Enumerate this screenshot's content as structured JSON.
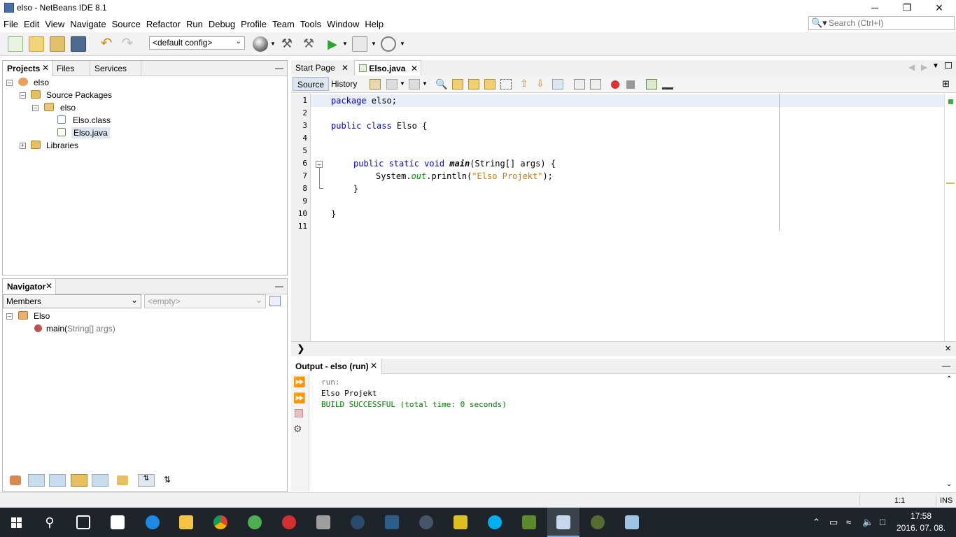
{
  "window": {
    "title": "elso - NetBeans IDE 8.1",
    "minimize": "─",
    "maximize": "❐",
    "close": "✕"
  },
  "menu": [
    "File",
    "Edit",
    "View",
    "Navigate",
    "Source",
    "Refactor",
    "Run",
    "Debug",
    "Profile",
    "Team",
    "Tools",
    "Window",
    "Help"
  ],
  "search": {
    "placeholder": "Search (Ctrl+I)",
    "icon": "magnifier-icon"
  },
  "toolbar": {
    "config_value": "<default config>"
  },
  "projects_panel": {
    "tabs": [
      "Projects",
      "Files",
      "Services"
    ],
    "tree": {
      "project": "elso",
      "source_packages": "Source Packages",
      "package": "elso",
      "files": [
        "Elso.class",
        "Elso.java"
      ],
      "libraries": "Libraries"
    }
  },
  "navigator": {
    "title": "Navigator",
    "members_select": "Members",
    "empty_select": "<empty>",
    "class_name": "Elso",
    "method_name": "main(",
    "method_params": "String[] args)"
  },
  "editor": {
    "tabs": [
      "Start Page",
      "Elso.java"
    ],
    "view_tabs": [
      "Source",
      "History"
    ],
    "line_numbers": [
      "1",
      "2",
      "3",
      "4",
      "5",
      "6",
      "7",
      "8",
      "9",
      "10",
      "11"
    ],
    "code": {
      "l1_kw": "package",
      "l1_rest": " elso;",
      "l3_kw": "public class",
      "l3_rest": " Elso {",
      "l6_kw": "public static void",
      "l6_name": "main",
      "l6_rest": "(String[] args) {",
      "l7_a": "System.",
      "l7_out": "out",
      "l7_b": ".println(",
      "l7_str": "\"Elso Projekt\"",
      "l7_c": ");",
      "l8": "}",
      "l10": "}"
    }
  },
  "output": {
    "title": "Output - elso (run)",
    "lines": {
      "run": "run:",
      "result": "Elso Projekt",
      "build": "BUILD SUCCESSFUL (total time: 0 seconds)"
    }
  },
  "status": {
    "position": "1:1",
    "mode": "INS"
  },
  "taskbar": {
    "time": "17:58",
    "date": "2016. 07. 08."
  },
  "colors": {
    "keyword": "#0000e6",
    "string": "#ce7b00",
    "build_success": "#008000",
    "taskbar_bg": "#1e2429"
  }
}
